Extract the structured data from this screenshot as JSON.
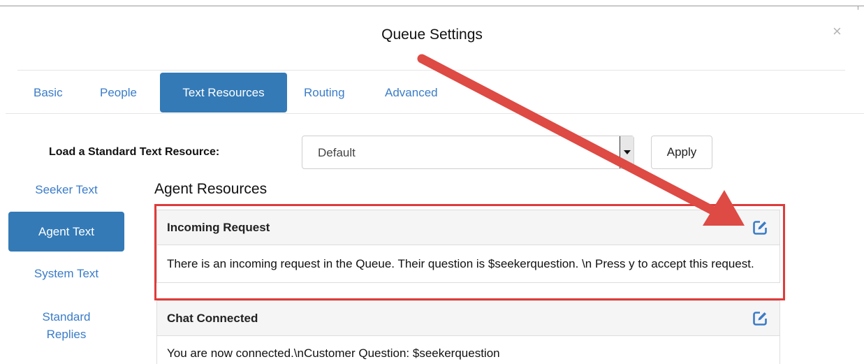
{
  "modal": {
    "title": "Queue Settings",
    "close_glyph": "×"
  },
  "tabs": [
    {
      "label": "Basic"
    },
    {
      "label": "People"
    },
    {
      "label": "Text Resources"
    },
    {
      "label": "Routing"
    },
    {
      "label": "Advanced"
    }
  ],
  "load_resource": {
    "label": "Load a Standard Text Resource:",
    "selected": "Default",
    "apply_label": "Apply"
  },
  "sidebar": {
    "items": [
      {
        "label": "Seeker Text"
      },
      {
        "label": "Agent Text"
      },
      {
        "label": "System Text"
      },
      {
        "label": "Standard Replies"
      }
    ]
  },
  "section": {
    "title": "Agent Resources"
  },
  "panels": [
    {
      "title": "Incoming Request",
      "body": "There is an incoming request in the Queue. Their question is $seekerquestion. \\n Press y to accept this request."
    },
    {
      "title": "Chat Connected",
      "body": "You are now connected.\\nCustomer Question: $seekerquestion"
    }
  ],
  "colors": {
    "accent": "#337ab7",
    "link": "#3a7cc8",
    "annotation": "#de3b3b"
  },
  "icons": {
    "close": "close-icon",
    "edit": "edit-icon",
    "caret": "caret-down-icon"
  }
}
